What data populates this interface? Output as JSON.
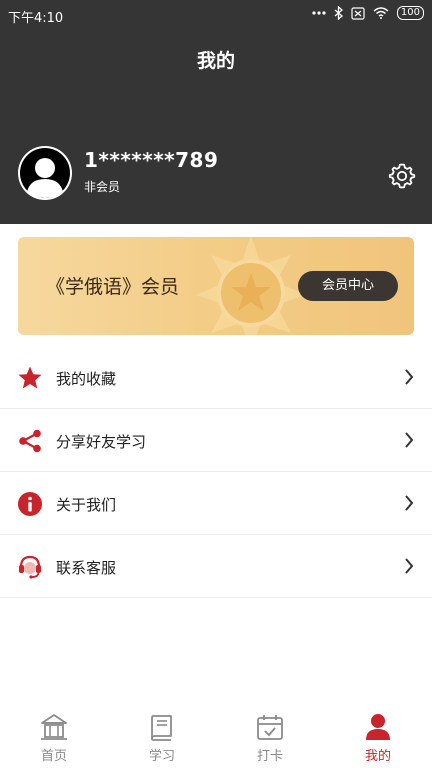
{
  "status_bar": {
    "time": "下午4:10",
    "battery": "100"
  },
  "header": {
    "title": "我的",
    "username": "1*******789",
    "member_status": "非会员"
  },
  "banner": {
    "title": "《学俄语》会员",
    "button_label": "会员中心"
  },
  "menu": {
    "items": [
      {
        "label": "我的收藏",
        "icon": "star-icon"
      },
      {
        "label": "分享好友学习",
        "icon": "share-icon"
      },
      {
        "label": "关于我们",
        "icon": "info-icon"
      },
      {
        "label": "联系客服",
        "icon": "headset-icon"
      }
    ]
  },
  "bottom_nav": {
    "items": [
      {
        "label": "首页",
        "icon": "home-icon"
      },
      {
        "label": "学习",
        "icon": "book-icon"
      },
      {
        "label": "打卡",
        "icon": "calendar-check-icon"
      },
      {
        "label": "我的",
        "icon": "user-icon",
        "active": true
      }
    ]
  },
  "colors": {
    "accent": "#c9232b",
    "header_bg": "#353535",
    "banner_gold": "#f3cc86"
  }
}
